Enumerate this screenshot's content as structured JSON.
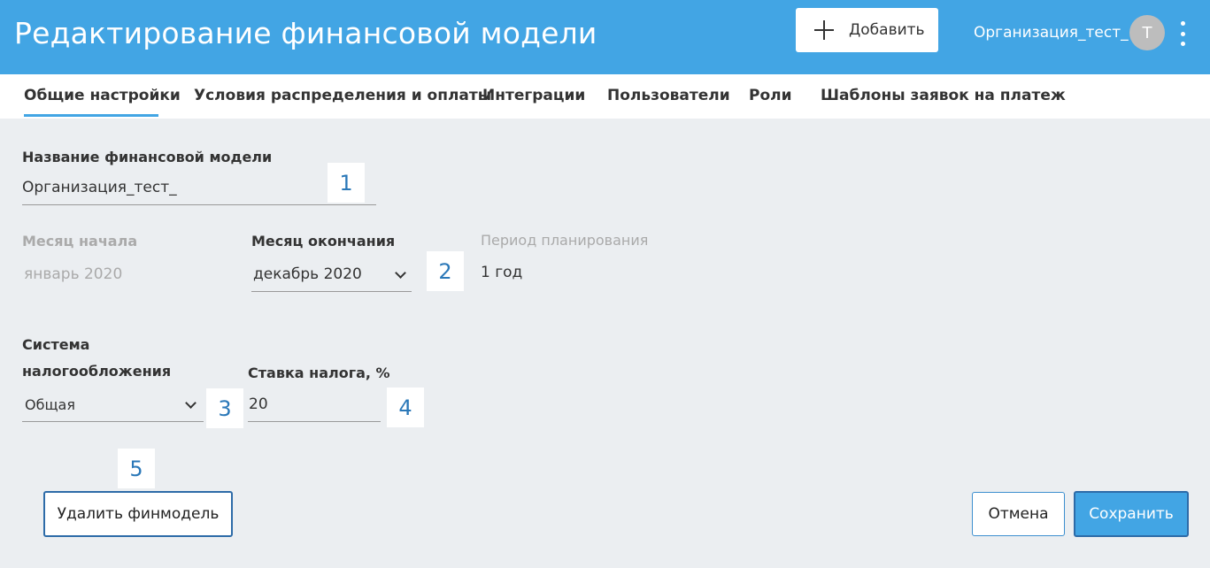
{
  "header": {
    "title": "Редактирование финансовой модели",
    "add_button_label": "Добавить",
    "org_name": "Организация_тест_",
    "avatar_initial": "T"
  },
  "tabs": [
    {
      "label": "Общие настройки",
      "active": true
    },
    {
      "label": "Условия распределения и оплаты"
    },
    {
      "label": "Интеграции"
    },
    {
      "label": "Пользователи"
    },
    {
      "label": "Роли"
    },
    {
      "label": "Шаблоны заявок на платеж"
    }
  ],
  "form": {
    "model_name_label": "Название финансовой модели",
    "model_name_value": "Организация_тест_",
    "start_month_label": "Месяц начала",
    "start_month_value": "январь 2020",
    "end_month_label": "Месяц окончания",
    "end_month_value": "декабрь 2020",
    "period_label": "Период планирования",
    "period_value": "1 год",
    "tax_system_label_line1": "Система",
    "tax_system_label_line2": "налогообложения",
    "tax_system_value": "Общая",
    "tax_rate_label": "Ставка налога, %",
    "tax_rate_value": "20"
  },
  "markers": [
    "1",
    "2",
    "3",
    "4",
    "5"
  ],
  "actions": {
    "delete_label": "Удалить финмодель",
    "cancel_label": "Отмена",
    "save_label": "Сохранить"
  },
  "colors": {
    "header_bg": "#42a5e4",
    "accent": "#42a5e4",
    "page_bg": "#ebeef1"
  },
  "icons": [
    "plus-icon",
    "kebab-menu-icon",
    "chevron-down-icon"
  ]
}
